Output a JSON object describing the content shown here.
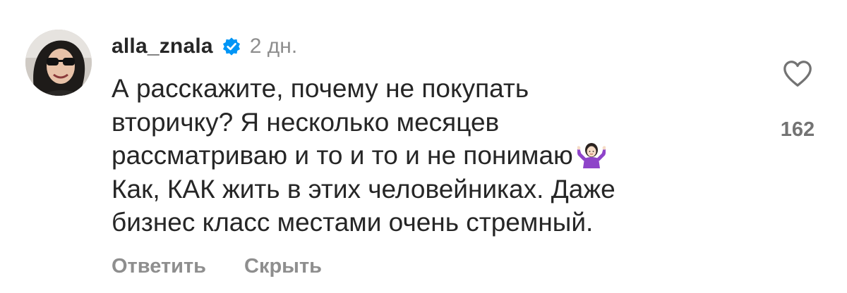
{
  "comment": {
    "username": "alla_znala",
    "verified_icon": "verified-badge-icon",
    "time": "2 дн.",
    "text_lines": [
      "А расскажите, почему не покупать",
      "вторичку? Я несколько месяцев",
      "рассматриваю и то и то и не понимаю",
      "Как, КАК жить в этих человейниках. Даже",
      "бизнес класс местами очень стремный."
    ],
    "emoji_icon": "woman-shrugging-icon",
    "like_icon": "heart-outline-icon",
    "like_count": "162",
    "reply_label": "Ответить",
    "hide_label": "Скрыть"
  },
  "colors": {
    "text": "#262626",
    "muted": "#8e8e8e",
    "count": "#737373",
    "verified": "#0095f6",
    "background": "#ffffff"
  }
}
